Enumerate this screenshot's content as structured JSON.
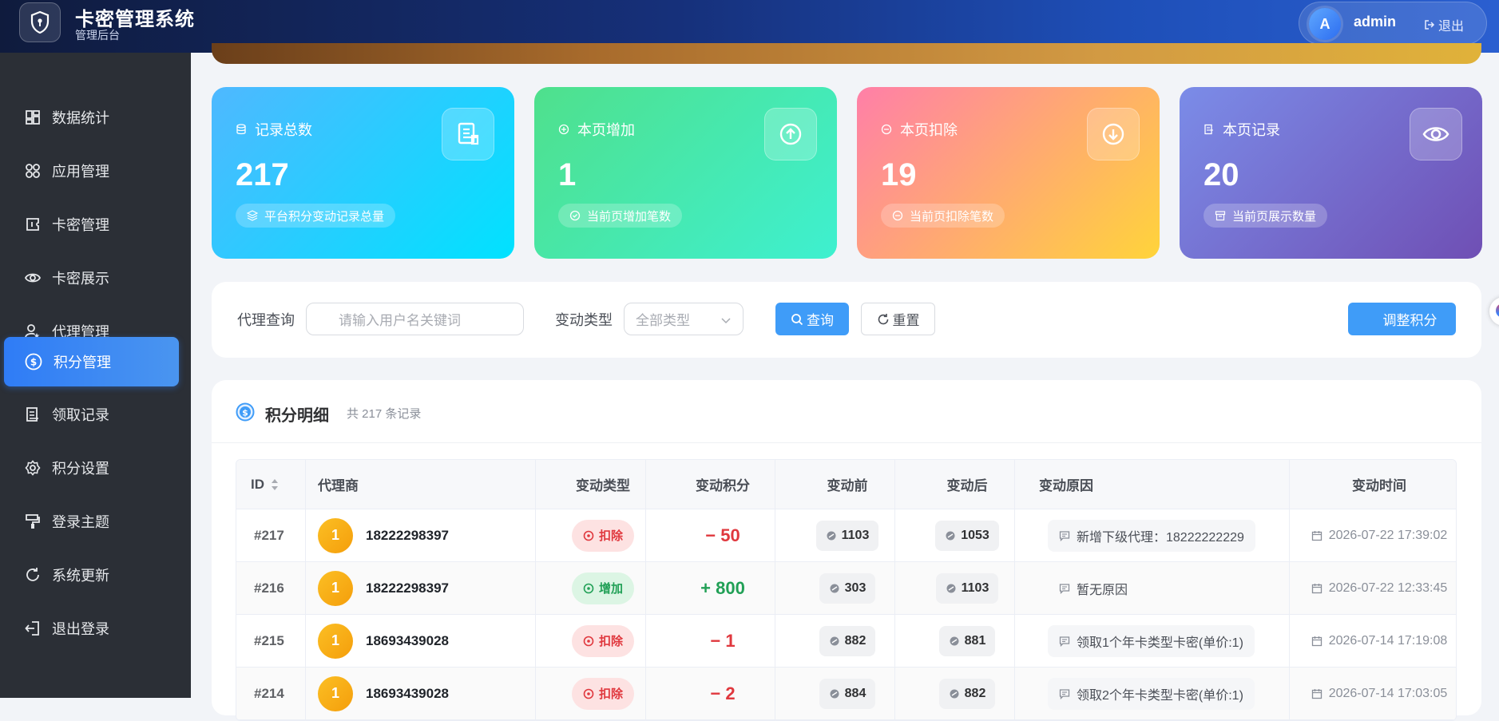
{
  "header": {
    "app_title": "卡密管理系统",
    "app_subtitle": "管理后台",
    "avatar_letter": "A",
    "user_name": "admin",
    "logout_label": "退出"
  },
  "sidebar": {
    "items": [
      {
        "label": "数据统计",
        "icon": "dashboard-icon"
      },
      {
        "label": "应用管理",
        "icon": "apps-icon"
      },
      {
        "label": "卡密管理",
        "icon": "ticket-icon"
      },
      {
        "label": "卡密展示",
        "icon": "eye-icon"
      },
      {
        "label": "代理管理",
        "icon": "user-star-icon"
      },
      {
        "label": "积分管理",
        "icon": "coin-icon",
        "active": true
      },
      {
        "label": "领取记录",
        "icon": "document-icon"
      },
      {
        "label": "积分设置",
        "icon": "gear-icon"
      },
      {
        "label": "登录主题",
        "icon": "paint-roller-icon"
      },
      {
        "label": "系统更新",
        "icon": "refresh-icon"
      },
      {
        "label": "退出登录",
        "icon": "logout-icon"
      }
    ]
  },
  "stats": [
    {
      "label": "记录总数",
      "value": "217",
      "chip": "平台积分变动记录总量",
      "colors": [
        "#4fb8ff",
        "#00e2ff"
      ]
    },
    {
      "label": "本页增加",
      "value": "1",
      "chip": "当前页增加笔数",
      "colors": [
        "#4fe08c",
        "#3ef0d0"
      ]
    },
    {
      "label": "本页扣除",
      "value": "19",
      "chip": "当前页扣除笔数",
      "colors": [
        "#ff7fa8",
        "#ffd43a"
      ]
    },
    {
      "label": "本页记录",
      "value": "20",
      "chip": "当前页展示数量",
      "colors": [
        "#7b8ce8",
        "#6f4fb4"
      ]
    }
  ],
  "filter": {
    "agent_label": "代理查询",
    "agent_placeholder": "请输入用户名关键词",
    "type_label": "变动类型",
    "type_value": "全部类型",
    "search_label": "查询",
    "reset_label": "重置",
    "adjust_label": "调整积分"
  },
  "detail": {
    "title": "积分明细",
    "count_text": "共 217 条记录",
    "columns": [
      "ID",
      "代理商",
      "变动类型",
      "变动积分",
      "变动前",
      "变动后",
      "变动原因",
      "变动时间"
    ],
    "rows": [
      {
        "id": "#217",
        "avatar": "1",
        "agent": "18222298397",
        "type": "扣除",
        "kind": "deduct",
        "amount": "− 50",
        "before": "1103",
        "after": "1053",
        "reason": "新增下级代理：18222222229",
        "time": "2026-07-22 17:39:02"
      },
      {
        "id": "#216",
        "avatar": "1",
        "agent": "18222298397",
        "type": "增加",
        "kind": "add",
        "amount": "+ 800",
        "before": "303",
        "after": "1103",
        "reason": "暂无原因",
        "time": "2026-07-22 12:33:45"
      },
      {
        "id": "#215",
        "avatar": "1",
        "agent": "18693439028",
        "type": "扣除",
        "kind": "deduct",
        "amount": "− 1",
        "before": "882",
        "after": "881",
        "reason": "领取1个年卡类型卡密(单价:1)",
        "time": "2026-07-14 17:19:08"
      },
      {
        "id": "#214",
        "avatar": "1",
        "agent": "18693439028",
        "type": "扣除",
        "kind": "deduct",
        "amount": "− 2",
        "before": "884",
        "after": "882",
        "reason": "领取2个年卡类型卡密(单价:1)",
        "time": "2026-07-14 17:03:05"
      }
    ]
  }
}
